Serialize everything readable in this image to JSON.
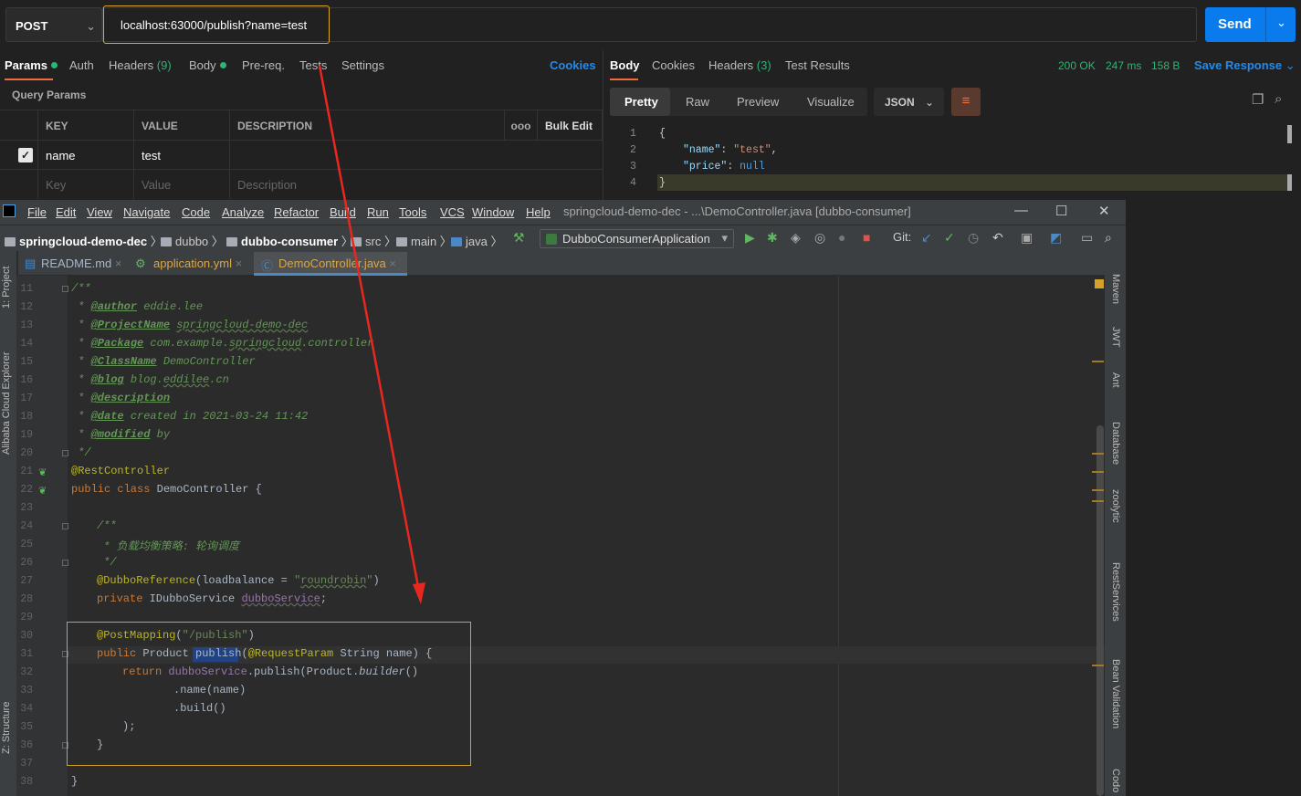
{
  "postman": {
    "method": "POST",
    "url": "localhost:63000/publish?name=test",
    "send_label": "Send",
    "request_tabs": [
      {
        "label": "Params",
        "dot": true
      },
      {
        "label": "Auth"
      },
      {
        "label": "Headers",
        "count": "(9)"
      },
      {
        "label": "Body",
        "dot": true
      },
      {
        "label": "Pre-req."
      },
      {
        "label": "Tests"
      },
      {
        "label": "Settings"
      }
    ],
    "cookies_link": "Cookies",
    "query_params_title": "Query Params",
    "table_headers": {
      "key": "KEY",
      "value": "VALUE",
      "description": "DESCRIPTION",
      "more": "ooo",
      "bulk_edit": "Bulk Edit"
    },
    "param_row": {
      "key": "name",
      "value": "test",
      "checked": true
    },
    "placeholder_row": {
      "key": "Key",
      "value": "Value",
      "description": "Description"
    },
    "response_tabs": [
      {
        "label": "Body"
      },
      {
        "label": "Cookies"
      },
      {
        "label": "Headers",
        "count": "(3)"
      },
      {
        "label": "Test Results"
      }
    ],
    "status": "200 OK",
    "time": "247 ms",
    "size": "158 B",
    "save_response": "Save Response",
    "format_tabs": [
      "Pretty",
      "Raw",
      "Preview",
      "Visualize"
    ],
    "format_select": "JSON",
    "response_lines": [
      "1",
      "2",
      "3",
      "4"
    ]
  },
  "ide": {
    "menu": [
      "File",
      "Edit",
      "View",
      "Navigate",
      "Code",
      "Analyze",
      "Refactor",
      "Build",
      "Run",
      "Tools",
      "VCS",
      "Window",
      "Help"
    ],
    "window_title": "springcloud-demo-dec - ...\\DemoController.java [dubbo-consumer]",
    "breadcrumbs": [
      "springcloud-demo-dec",
      "dubbo",
      "dubbo-consumer",
      "src",
      "main",
      "java"
    ],
    "run_config": "DubboConsumerApplication",
    "git_label": "Git:",
    "file_tabs": [
      "README.md",
      "application.yml",
      "DemoController.java"
    ],
    "left_tools": [
      "1: Project",
      "Alibaba Cloud Explorer",
      "Z: Structure"
    ],
    "right_tools": [
      "Maven",
      "JWT",
      "Ant",
      "Database",
      "zoolytic",
      "RestServices",
      "Bean Validation",
      "Codo"
    ],
    "line_numbers": [
      "11",
      "12",
      "13",
      "14",
      "15",
      "16",
      "17",
      "18",
      "19",
      "20",
      "21",
      "22",
      "23",
      "24",
      "25",
      "26",
      "27",
      "28",
      "29",
      "30",
      "31",
      "32",
      "33",
      "34",
      "35",
      "36",
      "37",
      "38"
    ]
  },
  "colors": {
    "accent_orange": "#f26b3a",
    "send_blue": "#097bed",
    "highlight": "#e0a827",
    "arrow": "#e8271f"
  }
}
